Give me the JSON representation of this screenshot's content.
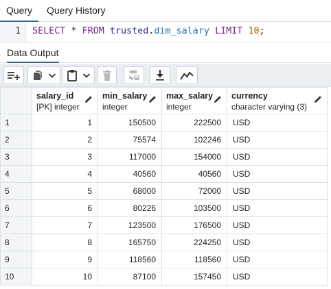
{
  "tabs": [
    {
      "label": "Query",
      "active": true
    },
    {
      "label": "Query History",
      "active": false
    }
  ],
  "editor": {
    "line_number": "1",
    "tokens": {
      "select": "SELECT",
      "star": "*",
      "from": "FROM",
      "schema": "trusted",
      "dot": ".",
      "table": "dim_salary",
      "limit": "LIMIT",
      "limit_value": "10",
      "semicolon": ";"
    }
  },
  "output_tab": {
    "label": "Data Output"
  },
  "toolbar": {
    "icons": [
      "add-row-icon",
      "copy-icon",
      "dropdown-icon",
      "paste-icon",
      "dropdown-icon",
      "delete-icon",
      "save-data-icon",
      "download-icon",
      "graph-visualiser-icon"
    ]
  },
  "grid": {
    "columns": [
      {
        "name": "salary_id",
        "type": "[PK] integer"
      },
      {
        "name": "min_salary",
        "type": "integer"
      },
      {
        "name": "max_salary",
        "type": "integer"
      },
      {
        "name": "currency",
        "type": "character varying (3)"
      }
    ],
    "rows": [
      {
        "n": "1",
        "salary_id": "1",
        "min_salary": "150500",
        "max_salary": "222500",
        "currency": "USD"
      },
      {
        "n": "2",
        "salary_id": "2",
        "min_salary": "75574",
        "max_salary": "102246",
        "currency": "USD"
      },
      {
        "n": "3",
        "salary_id": "3",
        "min_salary": "117000",
        "max_salary": "154000",
        "currency": "USD"
      },
      {
        "n": "4",
        "salary_id": "4",
        "min_salary": "40560",
        "max_salary": "40560",
        "currency": "USD"
      },
      {
        "n": "5",
        "salary_id": "5",
        "min_salary": "68000",
        "max_salary": "72000",
        "currency": "USD"
      },
      {
        "n": "6",
        "salary_id": "6",
        "min_salary": "80226",
        "max_salary": "103500",
        "currency": "USD"
      },
      {
        "n": "7",
        "salary_id": "7",
        "min_salary": "123500",
        "max_salary": "176500",
        "currency": "USD"
      },
      {
        "n": "8",
        "salary_id": "8",
        "min_salary": "165750",
        "max_salary": "224250",
        "currency": "USD"
      },
      {
        "n": "9",
        "salary_id": "9",
        "min_salary": "118560",
        "max_salary": "118560",
        "currency": "USD"
      },
      {
        "n": "10",
        "salary_id": "10",
        "min_salary": "87100",
        "max_salary": "157450",
        "currency": "USD"
      }
    ]
  },
  "colors": {
    "accent": "#326690",
    "keyword": "#7a1f8f",
    "number": "#a15c00",
    "toolbar_bg": "#ebeef3"
  }
}
